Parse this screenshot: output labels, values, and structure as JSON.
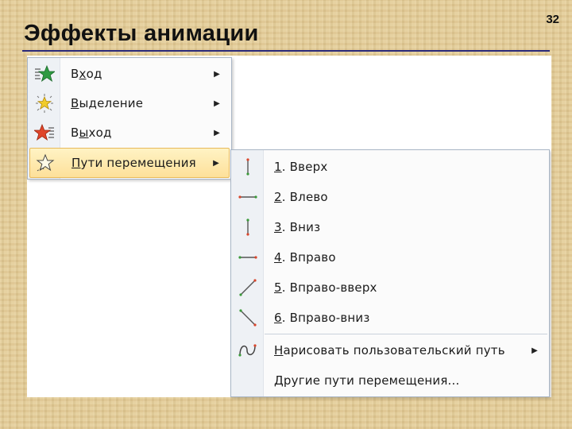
{
  "slide": {
    "title": "Эффекты анимации",
    "number": "32"
  },
  "main_menu": {
    "items": [
      {
        "pre": "В",
        "key": "х",
        "post": "од",
        "icon": "entrance-star-green-icon",
        "has_submenu": true
      },
      {
        "pre": "",
        "key": "В",
        "post": "ыделение",
        "icon": "emphasis-star-yellow-icon",
        "has_submenu": true
      },
      {
        "pre": "В",
        "key": "ы",
        "post": "ход",
        "icon": "exit-star-red-icon",
        "has_submenu": true
      },
      {
        "pre": "",
        "key": "П",
        "post": "ути перемещения",
        "icon": "motion-path-star-outline-icon",
        "has_submenu": true,
        "selected": true
      }
    ]
  },
  "sub_menu": {
    "items": [
      {
        "key": "1",
        "post": ". Вверх",
        "icon": "path-up-icon"
      },
      {
        "key": "2",
        "post": ". Влево",
        "icon": "path-left-icon"
      },
      {
        "key": "3",
        "post": ". Вниз",
        "icon": "path-down-icon"
      },
      {
        "key": "4",
        "post": ". Вправо",
        "icon": "path-right-icon"
      },
      {
        "key": "5",
        "post": ". Вправо-вверх",
        "icon": "path-diagonal-up-right-icon"
      },
      {
        "key": "6",
        "post": ". Вправо-вниз",
        "icon": "path-diagonal-down-right-icon"
      }
    ],
    "draw_custom": {
      "key": "Н",
      "post": "арисовать пользовательский путь",
      "icon": "custom-path-curve-icon",
      "has_submenu": true
    },
    "more_paths": {
      "key": "Д",
      "post": "ругие пути перемещения...",
      "icon": ""
    }
  },
  "colors": {
    "title_rule": "#2b2a7a",
    "highlight_top": "#fff3c4",
    "highlight_bottom": "#fde09a",
    "menu_border": "#a9b6c6"
  }
}
